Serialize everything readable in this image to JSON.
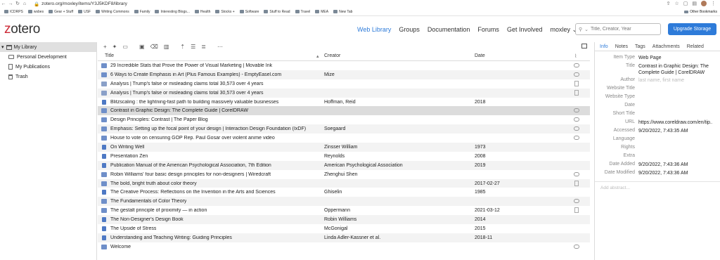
{
  "browser": {
    "url": "zotero.org/moxley/items/Y3J5KDF8/library",
    "bookmarks": [
      "ICDRPS",
      "wsbes",
      "Gear + Stuff",
      "USF",
      "Writing Commons",
      "Family",
      "Interesting Blogs...",
      "Health",
      "Stocks +",
      "Software",
      "Stuff to Read",
      "Travel",
      "MEA",
      "New Tab"
    ],
    "other_bookmarks": "Other Bookmarks"
  },
  "header": {
    "logo": "otero",
    "logo_z": "z",
    "nav": [
      "Web Library",
      "Groups",
      "Documentation",
      "Forums",
      "Get Involved",
      "moxley"
    ],
    "search_placeholder": "Title, Creator, Year",
    "upgrade_label": "Upgrade Storage"
  },
  "leftpane": {
    "library": "My Library",
    "items": [
      "Personal Development",
      "My Publications",
      "Trash"
    ]
  },
  "table": {
    "columns": {
      "title": "Title",
      "creator": "Creator",
      "date": "Date"
    },
    "rows": [
      {
        "title": "29 Incredible Stats that Prove the Power of Visual Marketing | Movable Ink",
        "creator": "",
        "date": "",
        "type": "web",
        "att": "snap"
      },
      {
        "title": "6 Ways to Create Emphasis in Art (Plus Famous Examples) - EmptyEasel.com",
        "creator": "Mize",
        "date": "",
        "type": "web",
        "att": "snap"
      },
      {
        "title": "Analysis | Trump's false or misleading claims total 30,573 over 4 years",
        "creator": "",
        "date": "",
        "type": "report",
        "att": "pdf"
      },
      {
        "title": "Analysis | Trump's false or misleading claims total 30,573 over 4 years",
        "creator": "",
        "date": "",
        "type": "report",
        "att": "pdf"
      },
      {
        "title": "Blitzscaling : the lightning-fast path to building massively valuable businesses",
        "creator": "Hoffman, Reid",
        "date": "2018",
        "type": "book",
        "att": ""
      },
      {
        "title": "Contrast in Graphic Design: The Complete Guide | CorelDRAW",
        "creator": "",
        "date": "",
        "type": "web",
        "att": "snap",
        "selected": true
      },
      {
        "title": "Design Principles: Contrast | The Paper Blog",
        "creator": "",
        "date": "",
        "type": "web",
        "att": "snap"
      },
      {
        "title": "Emphasis: Setting up the focal point of your design | Interaction Design Foundation (IxDF)",
        "creator": "Soegaard",
        "date": "",
        "type": "web",
        "att": "snap"
      },
      {
        "title": "House to vote on censuring GOP Rep. Paul Gosar over violent anime video",
        "creator": "",
        "date": "",
        "type": "web",
        "att": "snap"
      },
      {
        "title": "On Writing Well",
        "creator": "Zinsser William",
        "date": "1973",
        "type": "book",
        "att": ""
      },
      {
        "title": "Presentation Zen",
        "creator": "Reynolds",
        "date": "2008",
        "type": "book",
        "att": ""
      },
      {
        "title": "Publication Manual of the American Psychological Association, 7th Edition",
        "creator": "American Psychological Association",
        "date": "2019",
        "type": "book",
        "att": ""
      },
      {
        "title": "Robin Williams' four basic design principles for non-designers | Wiredcraft",
        "creator": "Zhenghui Shen",
        "date": "",
        "type": "web",
        "att": "snap"
      },
      {
        "title": "The bold, bright truth about color theory",
        "creator": "",
        "date": "2017-02-27",
        "type": "web",
        "att": "pdf"
      },
      {
        "title": "The Creative Process: Reflections on the Invention in the Arts and Sciences",
        "creator": "Ghiselin",
        "date": "1985",
        "type": "book",
        "att": ""
      },
      {
        "title": "The Fundamentals of Color Theory",
        "creator": "",
        "date": "",
        "type": "web",
        "att": "snap"
      },
      {
        "title": "The gestalt principle of proximity — in action",
        "creator": "Oppermann",
        "date": "2021-03-12",
        "type": "web",
        "att": "pdf"
      },
      {
        "title": "The Non-Designer's Design Book",
        "creator": "Robin Williams",
        "date": "2014",
        "type": "book",
        "att": ""
      },
      {
        "title": "The Upside of Stress",
        "creator": "McGonigal",
        "date": "2015",
        "type": "book",
        "att": ""
      },
      {
        "title": "Understanding and Teaching Writing: Guiding Principles",
        "creator": "Linda Adler-Kassner et al.",
        "date": "2018-11",
        "type": "book",
        "att": ""
      },
      {
        "title": "Welcome",
        "creator": "",
        "date": "",
        "type": "web",
        "att": "snap"
      }
    ]
  },
  "details": {
    "tabs": [
      "Info",
      "Notes",
      "Tags",
      "Attachments",
      "Related"
    ],
    "fields": [
      {
        "label": "Item Type",
        "value": "Web Page"
      },
      {
        "label": "Title",
        "value": "Contrast in Graphic Design: The Complete Guide | CorelDRAW"
      },
      {
        "label": "Author",
        "value": "last name, first name",
        "placeholder": true
      },
      {
        "label": "Website Title",
        "value": ""
      },
      {
        "label": "Website Type",
        "value": ""
      },
      {
        "label": "Date",
        "value": ""
      },
      {
        "label": "Short Title",
        "value": ""
      },
      {
        "label": "URL",
        "value": "https://www.coreldraw.com/en/tip..."
      },
      {
        "label": "Accessed",
        "value": "9/20/2022, 7:43:35 AM"
      },
      {
        "label": "Language",
        "value": ""
      },
      {
        "label": "Rights",
        "value": ""
      },
      {
        "label": "Extra",
        "value": ""
      },
      {
        "label": "Date Added",
        "value": "9/20/2022, 7:43:36 AM"
      },
      {
        "label": "Date Modified",
        "value": "9/20/2022, 7:43:36 AM"
      }
    ],
    "abstract_placeholder": "Add abstract..."
  }
}
